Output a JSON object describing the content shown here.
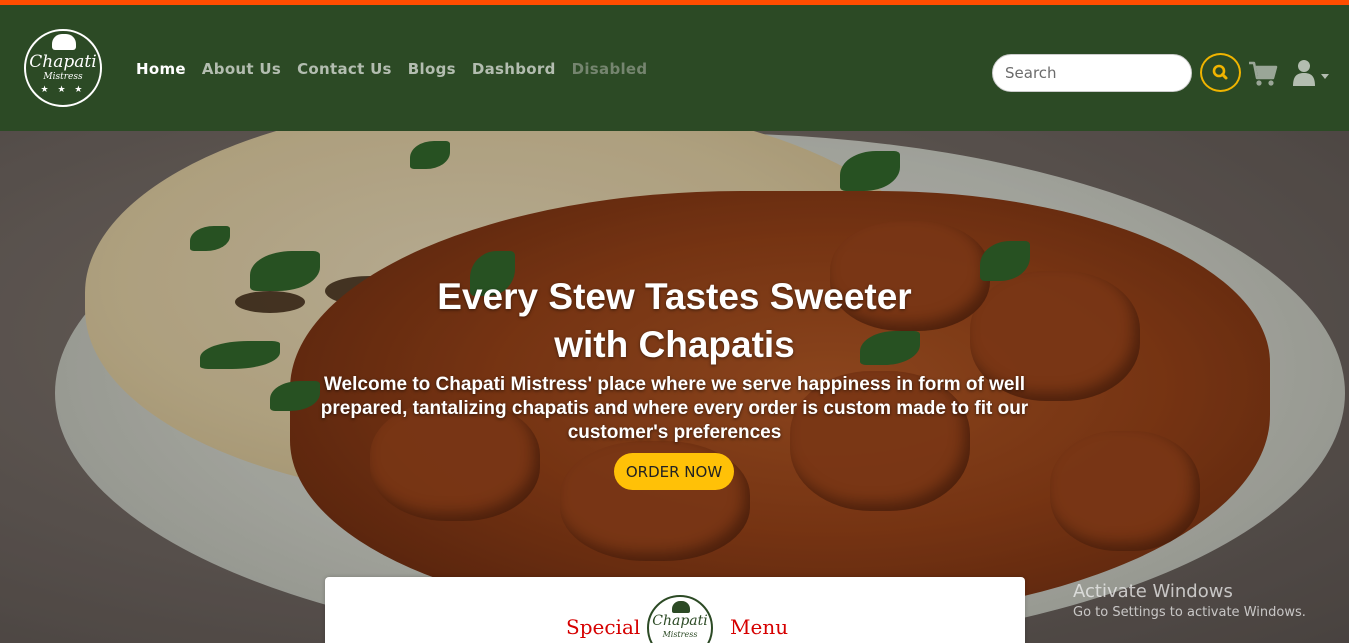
{
  "brand": {
    "name": "Chapati",
    "tagline": "Mistress",
    "stars": "★ ★ ★"
  },
  "nav": {
    "items": [
      {
        "label": "Home",
        "state": "active"
      },
      {
        "label": "About Us",
        "state": "normal"
      },
      {
        "label": "Contact Us",
        "state": "normal"
      },
      {
        "label": "Blogs",
        "state": "normal"
      },
      {
        "label": "Dashbord",
        "state": "normal"
      },
      {
        "label": "Disabled",
        "state": "disabled"
      }
    ]
  },
  "search": {
    "placeholder": "Search",
    "button_icon": "search-icon"
  },
  "icons": {
    "cart": "shopping-cart-icon",
    "user": "user-icon",
    "dropdown": "caret-down-icon"
  },
  "hero": {
    "title_line1": "Every Stew Tastes Sweeter",
    "title_line2": "with Chapatis",
    "text": "Welcome to Chapati Mistress' place where we serve happiness in form of well prepared, tantalizing chapatis and where every order is custom made to fit our customer's preferences",
    "cta": "ORDER NOW"
  },
  "special": {
    "left": "Special",
    "right": "Menu",
    "logo_brand": "Chapati",
    "logo_tagline": "Mistress"
  },
  "watermark": {
    "line1": "Activate Windows",
    "line2": "Go to Settings to activate Windows."
  },
  "colors": {
    "accent_stripe": "#ff4d00",
    "navbar": "#2c4a25",
    "cta": "#ffc107",
    "special_text": "#d60000"
  }
}
